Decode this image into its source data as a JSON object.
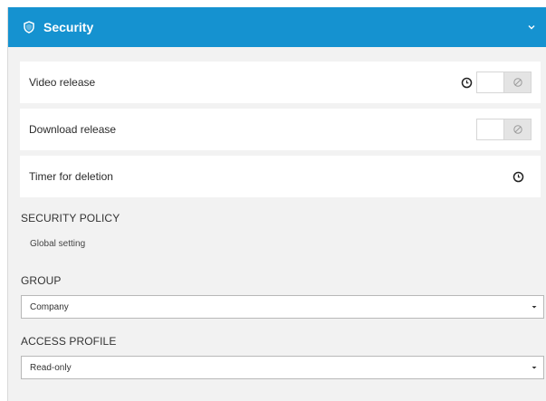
{
  "header": {
    "title": "Security",
    "icon": "shield-icon",
    "toggle_icon": "chevron-down-icon",
    "color": "#1592d0"
  },
  "settings": [
    {
      "label": "Video release",
      "has_timer_icon": true,
      "has_toggle": true,
      "toggle_on": false
    },
    {
      "label": "Download release",
      "has_timer_icon": false,
      "has_toggle": true,
      "toggle_on": false
    },
    {
      "label": "Timer for deletion",
      "has_timer_icon": true,
      "has_toggle": false
    }
  ],
  "security_policy": {
    "title": "SECURITY POLICY",
    "value": "Global setting"
  },
  "group": {
    "title": "GROUP",
    "selected": "Company"
  },
  "access_profile": {
    "title": "ACCESS PROFILE",
    "selected": "Read-only"
  }
}
